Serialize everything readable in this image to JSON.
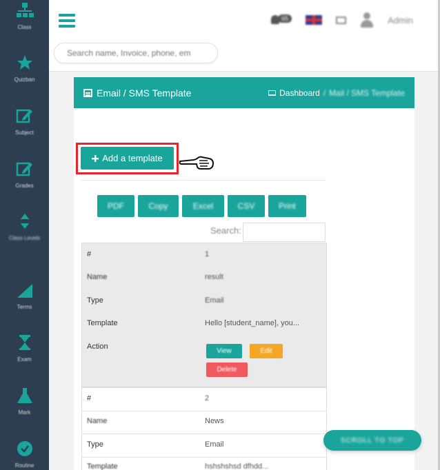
{
  "sidebar": {
    "items": [
      {
        "label": "Class",
        "icon": "sitemap-icon"
      },
      {
        "label": "Quizban",
        "icon": "star-icon"
      },
      {
        "label": "Subject",
        "icon": "edit-icon"
      },
      {
        "label": "Grades",
        "icon": "edit-icon"
      },
      {
        "label": "Class Levels",
        "icon": "sort-icon"
      },
      {
        "label": "Terms",
        "icon": "signal-icon"
      },
      {
        "label": "Exam",
        "icon": "hourglass-icon"
      },
      {
        "label": "Mark",
        "icon": "flask-icon"
      },
      {
        "label": "Routine",
        "icon": "clock-icon"
      }
    ]
  },
  "header": {
    "notification_count": "65",
    "user_name": "Admin",
    "search_placeholder": "Search name, Invoice, phone, em"
  },
  "card": {
    "title": "Email / SMS Template",
    "breadcrumb_home": "Dashboard",
    "breadcrumb_sep": "/",
    "breadcrumb_current": "Mail / SMS Template"
  },
  "add_button": "Add a template",
  "tools": [
    "PDF",
    "Copy",
    "Excel",
    "CSV",
    "Print"
  ],
  "table_search_label": "Search:",
  "records": [
    {
      "number": "1",
      "name": "result",
      "type": "Email",
      "template": "Hello [student_name], you..."
    },
    {
      "number": "2",
      "name": "News",
      "type": "Email",
      "template": "hshshshsd dfhdd..."
    }
  ],
  "field_labels": {
    "number": "#",
    "name": "Name",
    "type": "Type",
    "template": "Template",
    "action": "Action"
  },
  "actions": {
    "view": "View",
    "edit": "Edit",
    "delete": "Delete"
  },
  "scroll_top": "SCROLL TO TOP",
  "colors": {
    "accent": "#1aa59c",
    "sidebar": "#2d3e50",
    "highlight": "#e8232a",
    "edit": "#f5a623",
    "delete": "#f0595e"
  }
}
